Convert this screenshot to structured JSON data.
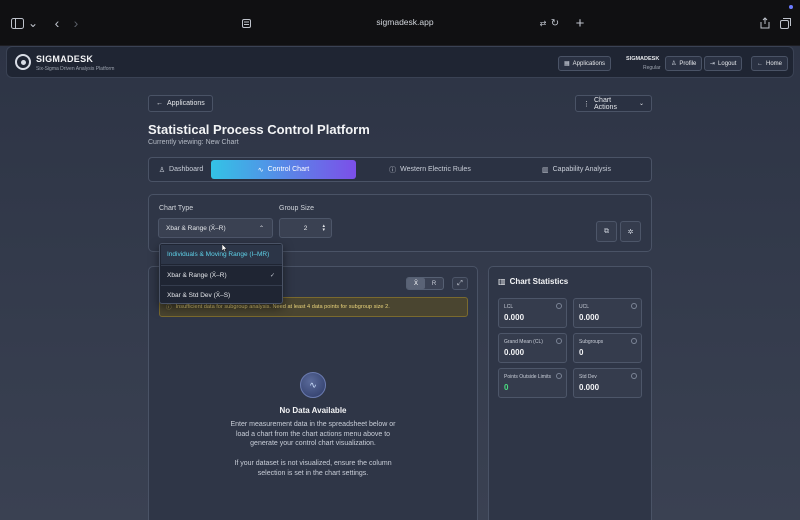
{
  "browser": {
    "url": "sigmadesk.app"
  },
  "header": {
    "brand": "SIGMADESK",
    "tagline": "Six-Sigma Driven Analysis Platform",
    "applications_label": "Applications",
    "user_name": "SIGMADESK",
    "user_role": "Regular",
    "profile_label": "Profile",
    "logout_label": "Logout",
    "home_label": "Home"
  },
  "nav": {
    "back_label": "Applications",
    "chart_actions_label": "Chart Actions"
  },
  "page": {
    "title": "Statistical Process Control Platform",
    "subtitle": "Currently viewing: New Chart"
  },
  "tabs": [
    {
      "label": "Dashboard",
      "icon": "user-icon"
    },
    {
      "label": "Control Chart",
      "icon": "activity-icon",
      "active": true
    },
    {
      "label": "Western Electric Rules",
      "icon": "alert-circle-icon"
    },
    {
      "label": "Capability Analysis",
      "icon": "bar-chart-icon"
    }
  ],
  "settings": {
    "chart_type_label": "Chart Type",
    "chart_type_value": "Xbar & Range (X̄–R)",
    "group_size_label": "Group Size",
    "group_size_value": "2"
  },
  "dropdown": {
    "options": [
      {
        "label": "Individuals & Moving Range (I–MR)",
        "highlighted": true
      },
      {
        "label": "Xbar & Range (X̄–R)",
        "selected": true
      },
      {
        "label": "Xbar & Std Dev (X̄–S)"
      }
    ]
  },
  "chart_panel": {
    "toggle_x": "X̄",
    "toggle_r": "R",
    "warning": "Insufficient data for subgroup analysis. Need at least 4 data points for subgroup size 2.",
    "no_data_title": "No Data Available",
    "no_data_text": "Enter measurement data in the spreadsheet below or load a chart from the chart actions menu above to generate your control chart visualization.",
    "no_data_hint": "If your dataset is not visualized, ensure the column selection is set in the chart settings."
  },
  "stats": {
    "title": "Chart Statistics",
    "items": [
      {
        "label": "LCL",
        "value": "0.000"
      },
      {
        "label": "UCL",
        "value": "0.000"
      },
      {
        "label": "Grand Mean (CL)",
        "value": "0.000"
      },
      {
        "label": "Subgroups",
        "value": "0"
      },
      {
        "label": "Points Outside Limits",
        "value": "0"
      },
      {
        "label": "Std Dev",
        "value": "0.000"
      }
    ]
  },
  "colors": {
    "accent_start": "#33c3e6",
    "accent_end": "#7c4fe8",
    "warning": "#e8d27a",
    "success": "#4ade80"
  }
}
